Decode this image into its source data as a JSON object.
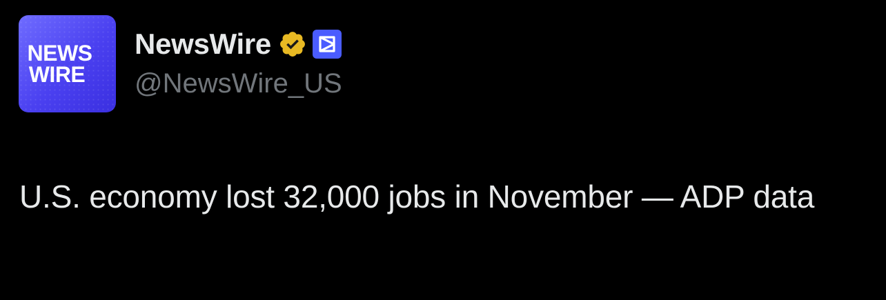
{
  "author": {
    "avatar_text_line1": "NEWS",
    "avatar_text_line2": "WIRE",
    "display_name": "NewsWire",
    "handle": "@NewsWire_US",
    "verified_badge_icon": "verified-badge-icon",
    "affiliate_badge_icon": "affiliate-badge-icon",
    "colors": {
      "avatar_gradient_start": "#6f6cff",
      "avatar_gradient_end": "#3a2fe0",
      "verified_badge": "#e8b923",
      "affiliate_badge": "#4a5cff",
      "name": "#e7e9ea",
      "handle": "#71767b"
    }
  },
  "post": {
    "text": "U.S. economy lost 32,000 jobs in November — ADP data"
  },
  "theme": {
    "background": "#000000"
  }
}
